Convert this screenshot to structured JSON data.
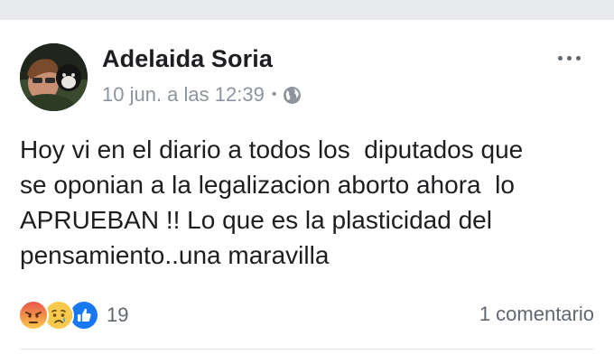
{
  "post": {
    "author": "Adelaida Soria",
    "timestamp": "10 jun. a las 12:39",
    "separator": "•",
    "privacy_icon": "globe-icon",
    "more_icon": "more-options-icon",
    "text": "Hoy vi en el diario a todos los  diputados que\nse oponian a la legalizacion aborto ahora  lo\nAPRUEBAN !! Lo que es la plasticidad del\npensamiento..una maravilla",
    "reactions": {
      "icons": [
        "angry-reaction-icon",
        "sad-reaction-icon",
        "like-reaction-icon"
      ],
      "count": "19"
    },
    "comments_label": "1 comentario"
  },
  "colors": {
    "page_background": "#e9eaee",
    "primary_text": "#1c1e21",
    "secondary_text": "#606770",
    "meta_text": "#8d949e",
    "like_blue": "#1877f2",
    "angry_red": "#e9544b",
    "sad_yellow": "#f7c94c"
  }
}
